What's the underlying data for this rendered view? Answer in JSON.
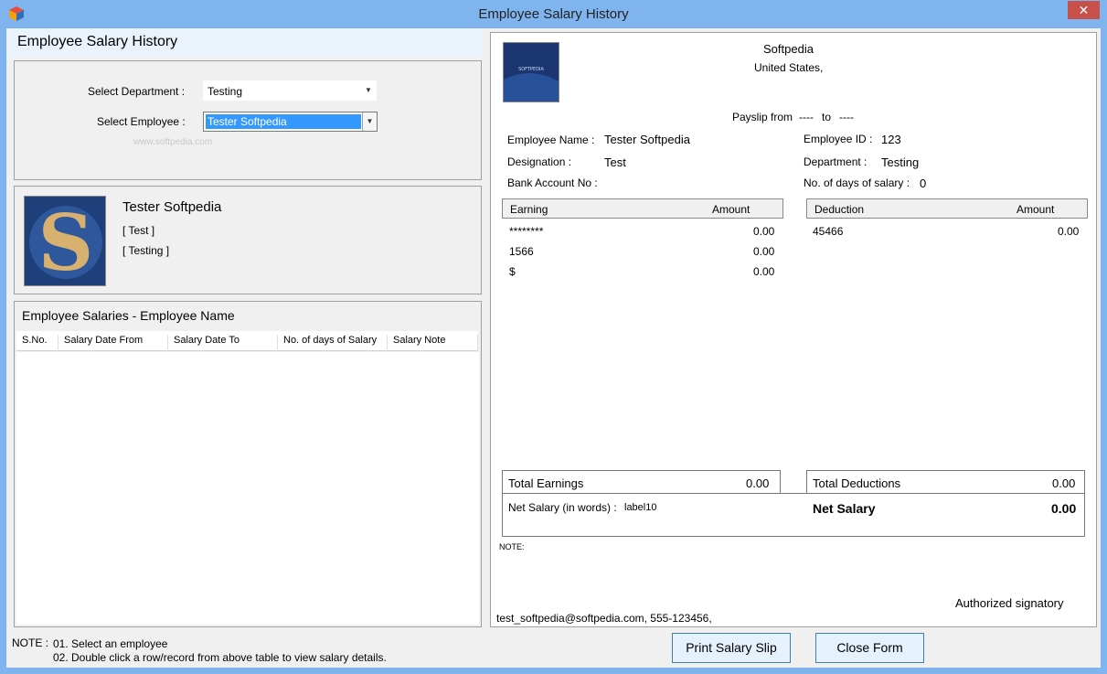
{
  "window": {
    "title": "Employee Salary History"
  },
  "left": {
    "heading": "Employee Salary History",
    "select_department_label": "Select Department :",
    "select_department_value": "Testing",
    "select_employee_label": "Select Employee :",
    "select_employee_value": "Tester  Softpedia",
    "watermark": "www.softpedia.com"
  },
  "profile": {
    "name": "Tester  Softpedia",
    "designation": "[ Test ]",
    "department": "[ Testing ]"
  },
  "salaries": {
    "title": "Employee Salaries - Employee Name",
    "columns": [
      "S.No.",
      "Salary Date From",
      "Salary Date To",
      "No. of days of Salary",
      "Salary Note"
    ]
  },
  "note": {
    "label": "NOTE :",
    "line1": "01. Select an employee",
    "line2": "02. Double click a row/record from above table to view salary details."
  },
  "payslip": {
    "company": "Softpedia",
    "country": "United States,",
    "payslip_from_label": "Payslip from",
    "from_value": "----",
    "to_label": "to",
    "to_value": "----",
    "emp_name_label": "Employee Name :",
    "emp_name_value": "Tester  Softpedia",
    "designation_label": "Designation :",
    "designation_value": "Test",
    "bank_label": "Bank Account No :",
    "emp_id_label": "Employee ID :",
    "emp_id_value": "123",
    "dept_label": "Department :",
    "dept_value": "Testing",
    "days_label": "No. of days of salary :",
    "days_value": "0",
    "earning_header": "Earning",
    "amount_header": "Amount",
    "deduction_header": "Deduction",
    "earnings": [
      {
        "name": "********",
        "amount": "0.00"
      },
      {
        "name": "1566",
        "amount": "0.00"
      },
      {
        "name": "$",
        "amount": "0.00"
      }
    ],
    "deductions": [
      {
        "name": "45466",
        "amount": "0.00"
      }
    ],
    "total_earnings_label": "Total Earnings",
    "total_earnings_value": "0.00",
    "total_deductions_label": "Total Deductions",
    "total_deductions_value": "0.00",
    "net_words_label": "Net Salary (in words) :",
    "net_words_value": "label10",
    "net_salary_label": "Net Salary",
    "net_salary_value": "0.00",
    "note_label": "NOTE:",
    "authorized": "Authorized signatory",
    "contact": "test_softpedia@softpedia.com, 555-123456,"
  },
  "buttons": {
    "print": "Print Salary Slip",
    "close": "Close Form"
  },
  "colors": {
    "titlebar": "#7fb4ef",
    "close": "#c7504a",
    "selection": "#3399ff"
  }
}
